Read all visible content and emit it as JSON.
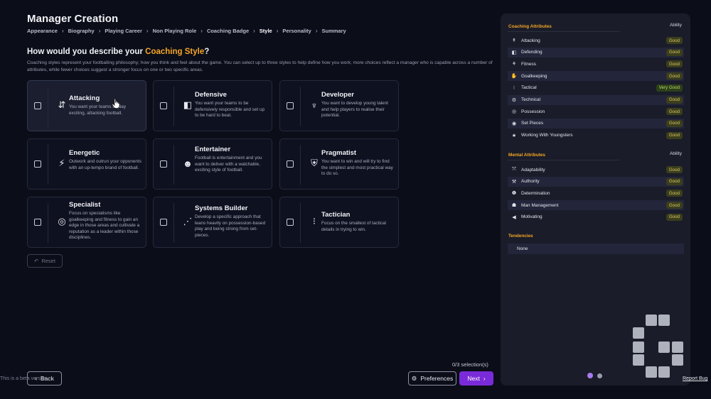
{
  "header": {
    "title": "Manager Creation",
    "breadcrumbs": [
      "Appearance",
      "Biography",
      "Playing Career",
      "Non Playing Role",
      "Coaching Badge",
      "Style",
      "Personality",
      "Summary"
    ],
    "active_crumb": "Style"
  },
  "question": {
    "prefix": "How would you describe your ",
    "highlight": "Coaching Style",
    "suffix": "?"
  },
  "description": "Coaching styles represent your footballing philosophy; how you think and feel about the game. You can select up to three styles to help define how you work; more choices reflect a manager who is capable across a number of attributes, while fewer choices suggest a stronger focus on one or two specific areas.",
  "styles": [
    {
      "title": "Attacking",
      "desc": "You want your teams to play exciting, attacking football.",
      "icon": "attacking-icon",
      "glyph": "⇵",
      "hovered": true
    },
    {
      "title": "Defensive",
      "desc": "You want your teams to be defensively responsible and set up to be hard to beat.",
      "icon": "defensive-icon",
      "glyph": "◧",
      "hovered": false
    },
    {
      "title": "Developer",
      "desc": "You want to develop young talent and help players to realise their potential.",
      "icon": "developer-icon",
      "glyph": "♆",
      "hovered": false
    },
    {
      "title": "Energetic",
      "desc": "Outwork and outrun your opponents with an up-tempo brand of football.",
      "icon": "energetic-icon",
      "glyph": "⚡",
      "hovered": false
    },
    {
      "title": "Entertainer",
      "desc": "Football is entertainment and you want to deliver with a watchable, exciting style of football.",
      "icon": "entertainer-icon",
      "glyph": "☻",
      "hovered": false
    },
    {
      "title": "Pragmatist",
      "desc": "You want to win and will try to find the simplest and most practical way to do so.",
      "icon": "pragmatist-icon",
      "glyph": "⛨",
      "hovered": false
    },
    {
      "title": "Specialist",
      "desc": "Focus on specialisms like goalkeeping and fitness to gain an edge in those areas and cultivate a reputation as a leader within those disciplines.",
      "icon": "specialist-icon",
      "glyph": "◎",
      "hovered": false
    },
    {
      "title": "Systems Builder",
      "desc": "Develop a specific approach that leans heavily on possession-based play and being strong from set-pieces.",
      "icon": "systems-builder-icon",
      "glyph": "⋰",
      "hovered": false
    },
    {
      "title": "Tactician",
      "desc": "Focus on the smallest of tactical details in trying to win.",
      "icon": "tactician-icon",
      "glyph": "⁝",
      "hovered": false
    }
  ],
  "reset_label": "Reset",
  "selection_count": "0/3 selection(s)",
  "buttons": {
    "back": "Back",
    "preferences": "Preferences",
    "next": "Next"
  },
  "beta_text": "This is a beta version",
  "panel": {
    "coaching_title": "Coaching Attributes",
    "ability_label": "Ability",
    "coaching": [
      {
        "label": "Attacking",
        "value": "Good",
        "icon": "attacking-icon",
        "glyph": "↟"
      },
      {
        "label": "Defending",
        "value": "Good",
        "icon": "defending-icon",
        "glyph": "◧"
      },
      {
        "label": "Fitness",
        "value": "Good",
        "icon": "fitness-icon",
        "glyph": "⚘"
      },
      {
        "label": "Goalkeeping",
        "value": "Good",
        "icon": "goalkeeping-icon",
        "glyph": "✋"
      },
      {
        "label": "Tactical",
        "value": "Very Good",
        "icon": "tactical-icon",
        "glyph": "⁝"
      },
      {
        "label": "Technical",
        "value": "Good",
        "icon": "technical-icon",
        "glyph": "⚙"
      },
      {
        "label": "Possession",
        "value": "Good",
        "icon": "possession-icon",
        "glyph": "◎"
      },
      {
        "label": "Set Pieces",
        "value": "Good",
        "icon": "set-pieces-icon",
        "glyph": "◉"
      },
      {
        "label": "Working With Youngsters",
        "value": "Good",
        "icon": "youngsters-icon",
        "glyph": "★"
      }
    ],
    "mental_title": "Mental Attributes",
    "mental": [
      {
        "label": "Adaptability",
        "value": "Good",
        "icon": "adaptability-icon",
        "glyph": "⤧"
      },
      {
        "label": "Authority",
        "value": "Good",
        "icon": "authority-icon",
        "glyph": "⚒"
      },
      {
        "label": "Determination",
        "value": "Good",
        "icon": "determination-icon",
        "glyph": "❶"
      },
      {
        "label": "Man Management",
        "value": "Good",
        "icon": "man-management-icon",
        "glyph": "☗"
      },
      {
        "label": "Motivating",
        "value": "Good",
        "icon": "motivating-icon",
        "glyph": "◀"
      }
    ],
    "tendencies_title": "Tendencies",
    "tendencies_value": "None"
  },
  "report_bug": "Report Bug",
  "colors": {
    "accent": "#f5a623",
    "primary_button": "#7a2bd9",
    "badge_good": "#3a3e1c",
    "badge_very_good": "#2c4019"
  }
}
